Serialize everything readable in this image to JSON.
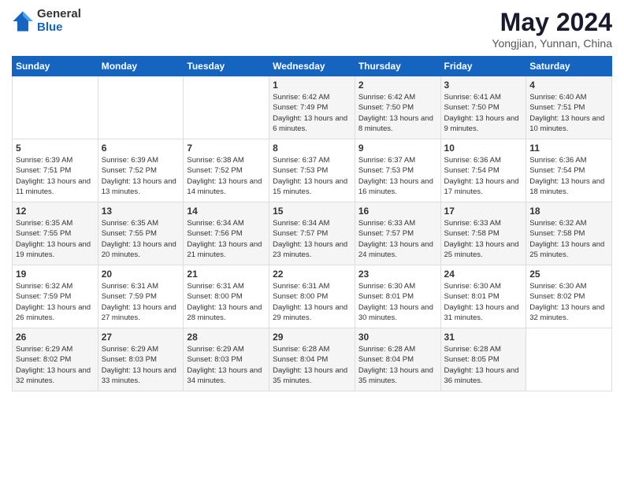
{
  "logo": {
    "general": "General",
    "blue": "Blue"
  },
  "title": "May 2024",
  "subtitle": "Yongjian, Yunnan, China",
  "weekdays": [
    "Sunday",
    "Monday",
    "Tuesday",
    "Wednesday",
    "Thursday",
    "Friday",
    "Saturday"
  ],
  "weeks": [
    [
      {
        "day": "",
        "content": ""
      },
      {
        "day": "",
        "content": ""
      },
      {
        "day": "",
        "content": ""
      },
      {
        "day": "1",
        "content": "Sunrise: 6:42 AM\nSunset: 7:49 PM\nDaylight: 13 hours\nand 6 minutes."
      },
      {
        "day": "2",
        "content": "Sunrise: 6:42 AM\nSunset: 7:50 PM\nDaylight: 13 hours\nand 8 minutes."
      },
      {
        "day": "3",
        "content": "Sunrise: 6:41 AM\nSunset: 7:50 PM\nDaylight: 13 hours\nand 9 minutes."
      },
      {
        "day": "4",
        "content": "Sunrise: 6:40 AM\nSunset: 7:51 PM\nDaylight: 13 hours\nand 10 minutes."
      }
    ],
    [
      {
        "day": "5",
        "content": "Sunrise: 6:39 AM\nSunset: 7:51 PM\nDaylight: 13 hours\nand 11 minutes."
      },
      {
        "day": "6",
        "content": "Sunrise: 6:39 AM\nSunset: 7:52 PM\nDaylight: 13 hours\nand 13 minutes."
      },
      {
        "day": "7",
        "content": "Sunrise: 6:38 AM\nSunset: 7:52 PM\nDaylight: 13 hours\nand 14 minutes."
      },
      {
        "day": "8",
        "content": "Sunrise: 6:37 AM\nSunset: 7:53 PM\nDaylight: 13 hours\nand 15 minutes."
      },
      {
        "day": "9",
        "content": "Sunrise: 6:37 AM\nSunset: 7:53 PM\nDaylight: 13 hours\nand 16 minutes."
      },
      {
        "day": "10",
        "content": "Sunrise: 6:36 AM\nSunset: 7:54 PM\nDaylight: 13 hours\nand 17 minutes."
      },
      {
        "day": "11",
        "content": "Sunrise: 6:36 AM\nSunset: 7:54 PM\nDaylight: 13 hours\nand 18 minutes."
      }
    ],
    [
      {
        "day": "12",
        "content": "Sunrise: 6:35 AM\nSunset: 7:55 PM\nDaylight: 13 hours\nand 19 minutes."
      },
      {
        "day": "13",
        "content": "Sunrise: 6:35 AM\nSunset: 7:55 PM\nDaylight: 13 hours\nand 20 minutes."
      },
      {
        "day": "14",
        "content": "Sunrise: 6:34 AM\nSunset: 7:56 PM\nDaylight: 13 hours\nand 21 minutes."
      },
      {
        "day": "15",
        "content": "Sunrise: 6:34 AM\nSunset: 7:57 PM\nDaylight: 13 hours\nand 23 minutes."
      },
      {
        "day": "16",
        "content": "Sunrise: 6:33 AM\nSunset: 7:57 PM\nDaylight: 13 hours\nand 24 minutes."
      },
      {
        "day": "17",
        "content": "Sunrise: 6:33 AM\nSunset: 7:58 PM\nDaylight: 13 hours\nand 25 minutes."
      },
      {
        "day": "18",
        "content": "Sunrise: 6:32 AM\nSunset: 7:58 PM\nDaylight: 13 hours\nand 25 minutes."
      }
    ],
    [
      {
        "day": "19",
        "content": "Sunrise: 6:32 AM\nSunset: 7:59 PM\nDaylight: 13 hours\nand 26 minutes."
      },
      {
        "day": "20",
        "content": "Sunrise: 6:31 AM\nSunset: 7:59 PM\nDaylight: 13 hours\nand 27 minutes."
      },
      {
        "day": "21",
        "content": "Sunrise: 6:31 AM\nSunset: 8:00 PM\nDaylight: 13 hours\nand 28 minutes."
      },
      {
        "day": "22",
        "content": "Sunrise: 6:31 AM\nSunset: 8:00 PM\nDaylight: 13 hours\nand 29 minutes."
      },
      {
        "day": "23",
        "content": "Sunrise: 6:30 AM\nSunset: 8:01 PM\nDaylight: 13 hours\nand 30 minutes."
      },
      {
        "day": "24",
        "content": "Sunrise: 6:30 AM\nSunset: 8:01 PM\nDaylight: 13 hours\nand 31 minutes."
      },
      {
        "day": "25",
        "content": "Sunrise: 6:30 AM\nSunset: 8:02 PM\nDaylight: 13 hours\nand 32 minutes."
      }
    ],
    [
      {
        "day": "26",
        "content": "Sunrise: 6:29 AM\nSunset: 8:02 PM\nDaylight: 13 hours\nand 32 minutes."
      },
      {
        "day": "27",
        "content": "Sunrise: 6:29 AM\nSunset: 8:03 PM\nDaylight: 13 hours\nand 33 minutes."
      },
      {
        "day": "28",
        "content": "Sunrise: 6:29 AM\nSunset: 8:03 PM\nDaylight: 13 hours\nand 34 minutes."
      },
      {
        "day": "29",
        "content": "Sunrise: 6:28 AM\nSunset: 8:04 PM\nDaylight: 13 hours\nand 35 minutes."
      },
      {
        "day": "30",
        "content": "Sunrise: 6:28 AM\nSunset: 8:04 PM\nDaylight: 13 hours\nand 35 minutes."
      },
      {
        "day": "31",
        "content": "Sunrise: 6:28 AM\nSunset: 8:05 PM\nDaylight: 13 hours\nand 36 minutes."
      },
      {
        "day": "",
        "content": ""
      }
    ]
  ]
}
